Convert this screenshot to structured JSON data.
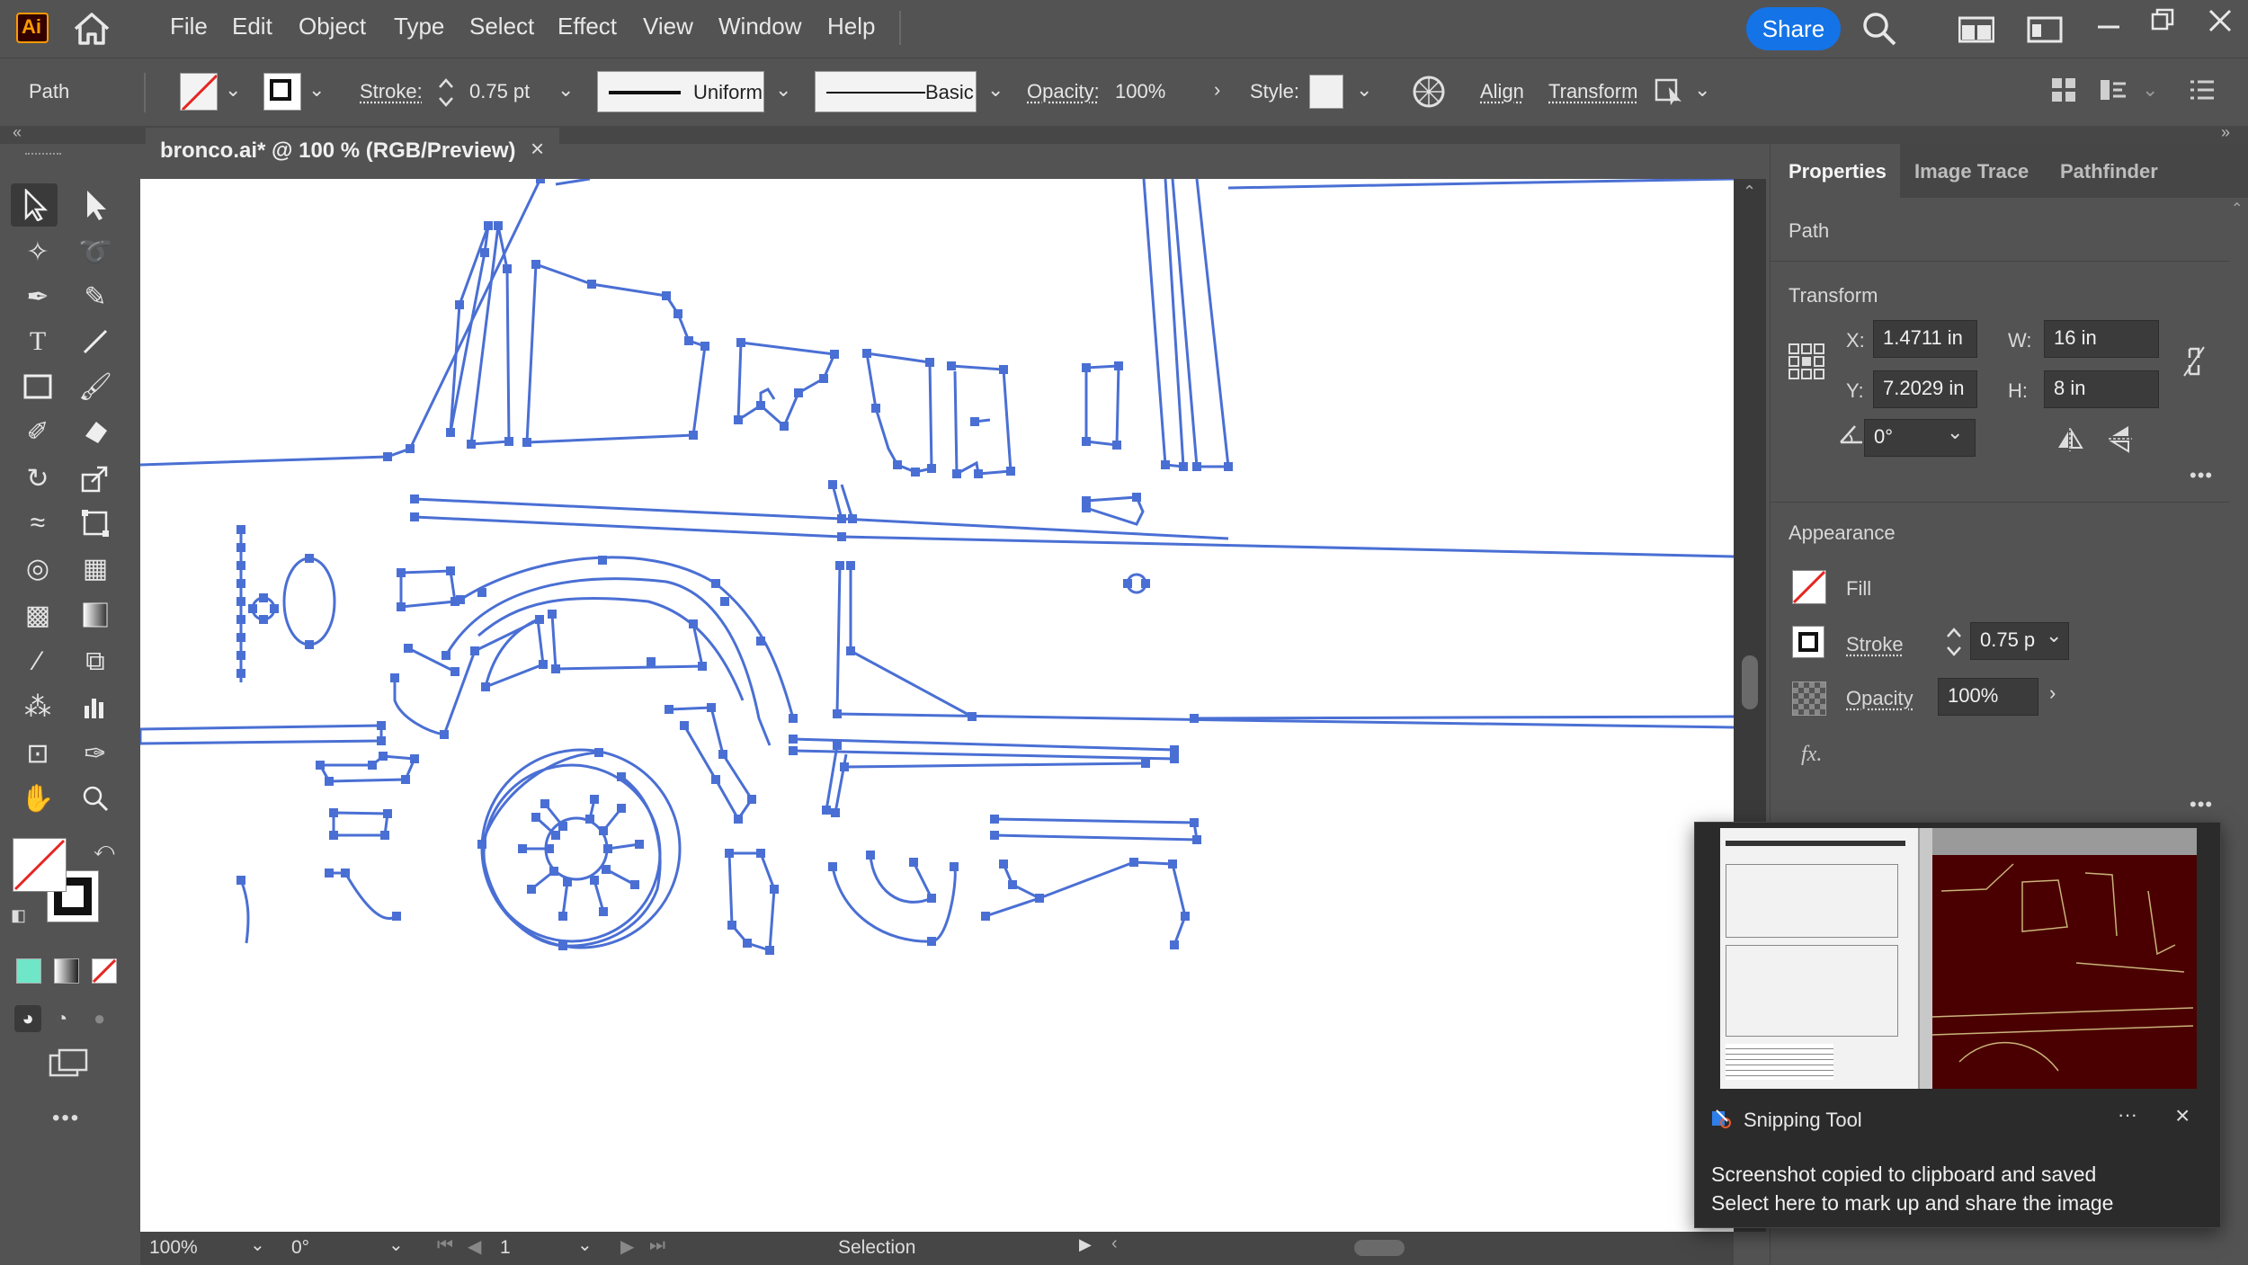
{
  "app": {
    "logo": "Ai",
    "menus": [
      "File",
      "Edit",
      "Object",
      "Type",
      "Select",
      "Effect",
      "View",
      "Window",
      "Help"
    ],
    "share_label": "Share"
  },
  "control": {
    "selection_type": "Path",
    "stroke_label": "Stroke:",
    "stroke_value": "0.75 pt",
    "profile_uniform": "Uniform",
    "brush_basic": "Basic",
    "opacity_label": "Opacity:",
    "opacity_value": "100%",
    "style_label": "Style:",
    "align_label": "Align",
    "transform_label": "Transform"
  },
  "document": {
    "tab_title": "bronco.ai* @ 100 % (RGB/Preview)",
    "close_glyph": "×"
  },
  "status": {
    "zoom": "100%",
    "rotation": "0°",
    "artboard": "1",
    "tool_name": "Selection"
  },
  "panel": {
    "tabs": [
      "Properties",
      "Image Trace",
      "Pathfinder"
    ],
    "active_tab": "Properties",
    "object_kind": "Path",
    "transform": {
      "title": "Transform",
      "x_label": "X:",
      "x_value": "1.4711 in",
      "y_label": "Y:",
      "y_value": "7.2029 in",
      "w_label": "W:",
      "w_value": "16 in",
      "h_label": "H:",
      "h_value": "8 in",
      "angle_value": "0°"
    },
    "appearance": {
      "title": "Appearance",
      "fill_label": "Fill",
      "stroke_label": "Stroke",
      "stroke_value": "0.75 p",
      "opacity_label": "Opacity",
      "opacity_value": "100%",
      "fx_label": "fx."
    },
    "more_glyph": "•••"
  },
  "toast": {
    "app_name": "Snipping Tool",
    "line1": "Screenshot copied to clipboard and saved",
    "line2": "Select here to mark up and share the image",
    "more_glyph": "···",
    "close_glyph": "×"
  },
  "colors": {
    "path_blue": "#4a6fd4",
    "share_blue": "#1473e6",
    "logo_bg": "#330000",
    "logo_fg": "#ff9a00",
    "fill_none_red": "#e52521"
  }
}
